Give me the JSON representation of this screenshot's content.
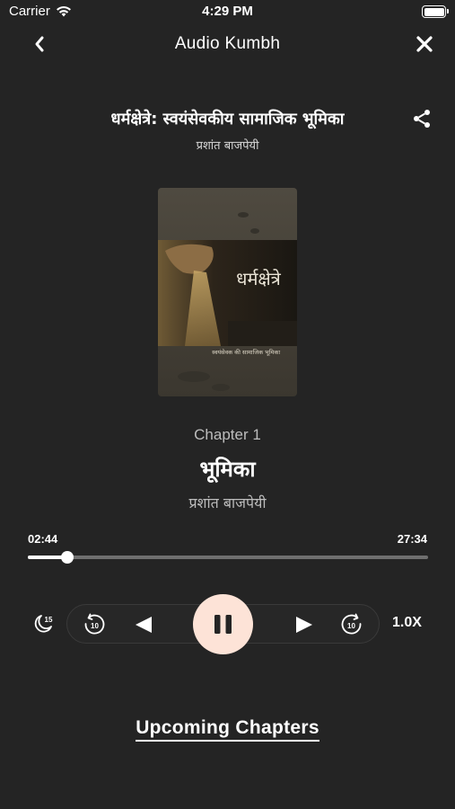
{
  "status_bar": {
    "carrier": "Carrier",
    "time": "4:29 PM"
  },
  "nav": {
    "title": "Audio Kumbh"
  },
  "book": {
    "title": "धर्मक्षेत्रे: स्वयंसेवकीय सामाजिक भूमिका",
    "author": "प्रशांत बाजपेयी",
    "cover_title_text": "धर्मक्षेत्रे",
    "cover_subtitle_text": "स्वयंसेवक की सामाजिक भूमिका"
  },
  "chapter": {
    "number_label": "Chapter 1",
    "title": "भूमिका",
    "author": "प्रशांत बाजपेयी"
  },
  "player": {
    "current_time": "02:44",
    "total_time": "27:34",
    "progress_fraction": 0.099,
    "sleep_timer_label": "15",
    "rewind_label": "10",
    "forward_label": "10",
    "speed_label": "1.0X",
    "state": "playing"
  },
  "upcoming": {
    "label": "Upcoming Chapters"
  },
  "colors": {
    "background": "#242424",
    "play_button": "#fde3d7",
    "track_unplayed": "#6f6f6f"
  },
  "icons": [
    "wifi-icon",
    "battery-icon",
    "back-chevron-icon",
    "close-icon",
    "share-icon",
    "sleep-timer-icon",
    "rewind-10-icon",
    "previous-icon",
    "pause-icon",
    "next-icon",
    "forward-10-icon"
  ]
}
